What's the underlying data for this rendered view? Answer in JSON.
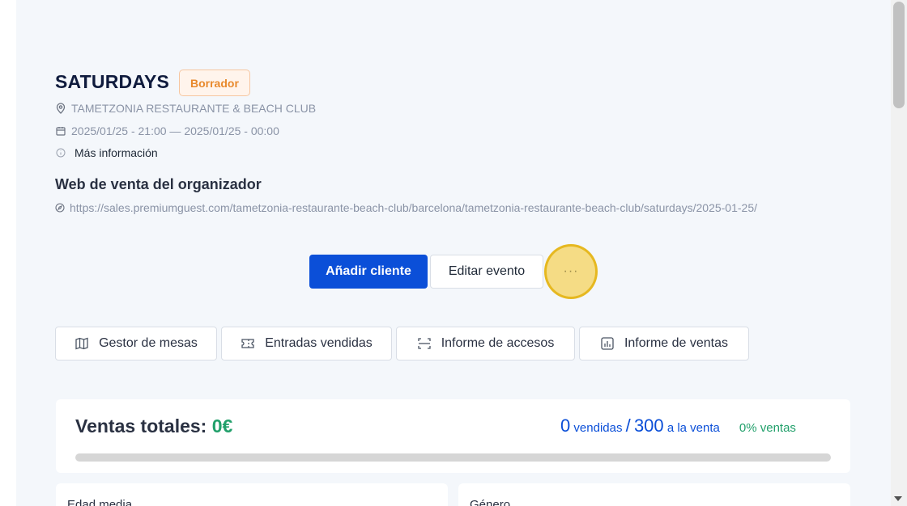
{
  "event": {
    "title": "SATURDAYS",
    "status_badge": "Borrador",
    "venue": "TAMETZONIA RESTAURANTE & BEACH CLUB",
    "dates": "2025/01/25 - 21:00 — 2025/01/25 - 00:00",
    "more_info": "Más información"
  },
  "organizer_web": {
    "title": "Web de venta del organizador",
    "url": "https://sales.premiumguest.com/tametzonia-restaurante-beach-club/barcelona/tametzonia-restaurante-beach-club/saturdays/2025-01-25/"
  },
  "actions": {
    "add_client": "Añadir cliente",
    "edit_event": "Editar evento",
    "more": "···"
  },
  "tools": [
    {
      "label": "Gestor de mesas",
      "icon": "map-icon"
    },
    {
      "label": "Entradas vendidas",
      "icon": "ticket-icon"
    },
    {
      "label": "Informe de accesos",
      "icon": "scan-icon"
    },
    {
      "label": "Informe de ventas",
      "icon": "bar-chart-icon"
    }
  ],
  "sales": {
    "label": "Ventas totales:",
    "total": "0€",
    "sold_count": "0",
    "sold_word": "vendidas",
    "separator": "/",
    "available_count": "300",
    "available_word": "a la venta",
    "percent_text": "0% ventas",
    "progress": 0
  },
  "stats": {
    "age_title": "Edad media",
    "gender_title": "Género"
  },
  "colors": {
    "primary": "#0b4fd8",
    "success": "#22a06b",
    "badge": "#e8892c"
  }
}
